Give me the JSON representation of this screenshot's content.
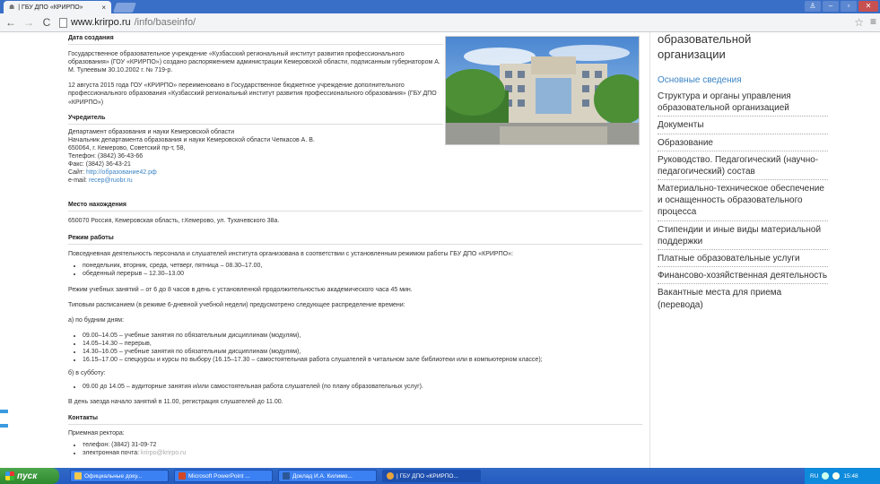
{
  "browser": {
    "tab_title": "| ГБУ ДПО «КРИРПО»",
    "tab_close": "×",
    "url_host": "www.krirpo.ru",
    "url_path": "/info/baseinfo/"
  },
  "main": {
    "sections": {
      "created_heading": "Дата создания",
      "created_p1": "Государственное образовательное учреждение «Кузбасский региональный институт развития профессионального образования» (ГОУ «КРИРПО») создано распоряжением администрации Кемеровской области, подписанным губернатором А. М. Тулеевым 30.10.2002 г. № 719-р.",
      "created_p2": "12 августа 2015 года ГОУ «КРИРПО» переименовано в Государственное бюджетное учреждение дополнительного профессионального образования «Кузбасский региональный институт развития профессионального образования» (ГБУ ДПО «КРИРПО»)",
      "founder_heading": "Учредитель",
      "founder_line1": "Департамент образования и науки Кемеровской области",
      "founder_line2": "Начальник департамента образования и науки Кемеровской области Чепкасов А. В.",
      "founder_line3": "650064, г. Кемерово, Советский пр-т, 58,",
      "founder_line4": "Телефон: (3842) 36-43-66",
      "founder_line5": "Факс: (3842) 36-43-21",
      "founder_site_label": "Сайт: ",
      "founder_site": "http://образование42.рф",
      "founder_email_label": "e-mail: ",
      "founder_email": "recep@ruobr.ru",
      "location_heading": "Место нахождения",
      "location_text": "650070 Россия, Кемеровская область, г.Кемерово, ул. Тухачевского 38а.",
      "schedule_heading": "Режим работы",
      "schedule_intro": "Повседневная деятельность персонала и слушателей института организована в соответствии с установленным режимом работы ГБУ ДПО «КРИРПО»:",
      "schedule_list": [
        "понедельник, вторник, среда, четверг, пятница – 08.30–17.00,",
        "обеденный перерыв – 12.30–13.00"
      ],
      "schedule_classes": "Режим учебных занятий – от 6 до 8 часов в день с установленной продолжительностью академического часа 45 мин.",
      "schedule_typical": "Типовым расписанием (в режиме 6-дневной учебной недели) предусмотрено следующее распределение времени:",
      "weekdays_label": "а) по будним дням:",
      "weekdays_list": [
        "09.00–14.05 – учебные занятия по обязательным дисциплинам (модулям),",
        "14.05–14.30 – перерыв,",
        "14.30–16.05 – учебные занятия по обязательным дисциплинам (модулям),",
        "16.15–17.00 – спецкурсы и курсы по выбору (16.15–17.30 – самостоятельная работа слушателей в читальном зале библиотеки или в компьютерном классе);"
      ],
      "saturday_label": "б) в субботу:",
      "saturday_list": [
        "09.00 до 14.05 – аудиторные занятия и/или самостоятельная работа слушателей (по плану образовательных услуг)."
      ],
      "arrival": "В день заезда начало занятий в 11.00, регистрация слушателей до 11.00.",
      "contacts_heading": "Контакты",
      "contacts_intro": "Приемная ректора:",
      "contacts_phone": "телефон: (3842) 31-09-72",
      "contacts_email_label": "электронная почта: ",
      "contacts_email": "krirpo@krirpo.ru"
    }
  },
  "sidebar": {
    "title": "образовательной организации",
    "items": [
      "Основные сведения",
      "Структура и органы управления образовательной организацией",
      "Документы",
      "Образование",
      "Руководство. Педагогический (научно-педагогический) состав",
      "Материально-техническое обеспечение и оснащенность образовательного процесса",
      "Стипендии и иные виды материальной поддержки",
      "Платные образовательные услуги",
      "Финансово-хозяйственная деятельность",
      "Вакантные места для приема (перевода)"
    ]
  },
  "taskbar": {
    "start": "пуск",
    "tasks": [
      "Официальные доку...",
      "Microsoft PowerPoint ...",
      "Доклад И.А. Килимо...",
      "| ГБУ ДПО «КРИРПО..."
    ],
    "lang": "RU",
    "clock": "15:48"
  },
  "colors": {
    "link": "#3b84c4",
    "taskbar": "#245bc0",
    "start": "#2f8a2f"
  }
}
